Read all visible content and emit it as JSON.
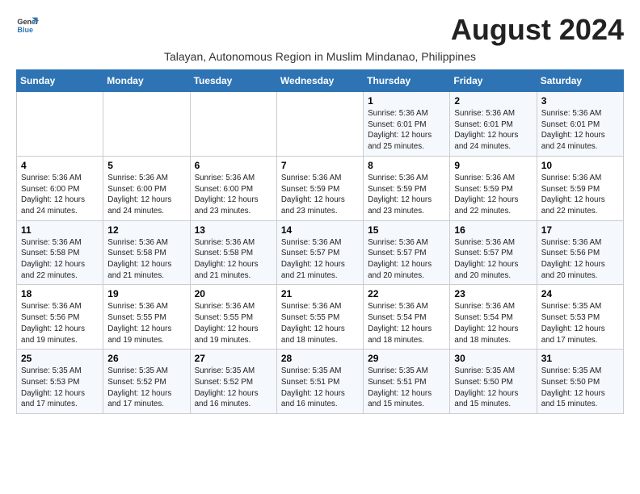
{
  "header": {
    "logo_line1": "General",
    "logo_line2": "Blue",
    "month_title": "August 2024",
    "subtitle": "Talayan, Autonomous Region in Muslim Mindanao, Philippines"
  },
  "days_of_week": [
    "Sunday",
    "Monday",
    "Tuesday",
    "Wednesday",
    "Thursday",
    "Friday",
    "Saturday"
  ],
  "weeks": [
    [
      {
        "day": "",
        "info": ""
      },
      {
        "day": "",
        "info": ""
      },
      {
        "day": "",
        "info": ""
      },
      {
        "day": "",
        "info": ""
      },
      {
        "day": "1",
        "info": "Sunrise: 5:36 AM\nSunset: 6:01 PM\nDaylight: 12 hours\nand 25 minutes."
      },
      {
        "day": "2",
        "info": "Sunrise: 5:36 AM\nSunset: 6:01 PM\nDaylight: 12 hours\nand 24 minutes."
      },
      {
        "day": "3",
        "info": "Sunrise: 5:36 AM\nSunset: 6:01 PM\nDaylight: 12 hours\nand 24 minutes."
      }
    ],
    [
      {
        "day": "4",
        "info": "Sunrise: 5:36 AM\nSunset: 6:00 PM\nDaylight: 12 hours\nand 24 minutes."
      },
      {
        "day": "5",
        "info": "Sunrise: 5:36 AM\nSunset: 6:00 PM\nDaylight: 12 hours\nand 24 minutes."
      },
      {
        "day": "6",
        "info": "Sunrise: 5:36 AM\nSunset: 6:00 PM\nDaylight: 12 hours\nand 23 minutes."
      },
      {
        "day": "7",
        "info": "Sunrise: 5:36 AM\nSunset: 5:59 PM\nDaylight: 12 hours\nand 23 minutes."
      },
      {
        "day": "8",
        "info": "Sunrise: 5:36 AM\nSunset: 5:59 PM\nDaylight: 12 hours\nand 23 minutes."
      },
      {
        "day": "9",
        "info": "Sunrise: 5:36 AM\nSunset: 5:59 PM\nDaylight: 12 hours\nand 22 minutes."
      },
      {
        "day": "10",
        "info": "Sunrise: 5:36 AM\nSunset: 5:59 PM\nDaylight: 12 hours\nand 22 minutes."
      }
    ],
    [
      {
        "day": "11",
        "info": "Sunrise: 5:36 AM\nSunset: 5:58 PM\nDaylight: 12 hours\nand 22 minutes."
      },
      {
        "day": "12",
        "info": "Sunrise: 5:36 AM\nSunset: 5:58 PM\nDaylight: 12 hours\nand 21 minutes."
      },
      {
        "day": "13",
        "info": "Sunrise: 5:36 AM\nSunset: 5:58 PM\nDaylight: 12 hours\nand 21 minutes."
      },
      {
        "day": "14",
        "info": "Sunrise: 5:36 AM\nSunset: 5:57 PM\nDaylight: 12 hours\nand 21 minutes."
      },
      {
        "day": "15",
        "info": "Sunrise: 5:36 AM\nSunset: 5:57 PM\nDaylight: 12 hours\nand 20 minutes."
      },
      {
        "day": "16",
        "info": "Sunrise: 5:36 AM\nSunset: 5:57 PM\nDaylight: 12 hours\nand 20 minutes."
      },
      {
        "day": "17",
        "info": "Sunrise: 5:36 AM\nSunset: 5:56 PM\nDaylight: 12 hours\nand 20 minutes."
      }
    ],
    [
      {
        "day": "18",
        "info": "Sunrise: 5:36 AM\nSunset: 5:56 PM\nDaylight: 12 hours\nand 19 minutes."
      },
      {
        "day": "19",
        "info": "Sunrise: 5:36 AM\nSunset: 5:55 PM\nDaylight: 12 hours\nand 19 minutes."
      },
      {
        "day": "20",
        "info": "Sunrise: 5:36 AM\nSunset: 5:55 PM\nDaylight: 12 hours\nand 19 minutes."
      },
      {
        "day": "21",
        "info": "Sunrise: 5:36 AM\nSunset: 5:55 PM\nDaylight: 12 hours\nand 18 minutes."
      },
      {
        "day": "22",
        "info": "Sunrise: 5:36 AM\nSunset: 5:54 PM\nDaylight: 12 hours\nand 18 minutes."
      },
      {
        "day": "23",
        "info": "Sunrise: 5:36 AM\nSunset: 5:54 PM\nDaylight: 12 hours\nand 18 minutes."
      },
      {
        "day": "24",
        "info": "Sunrise: 5:35 AM\nSunset: 5:53 PM\nDaylight: 12 hours\nand 17 minutes."
      }
    ],
    [
      {
        "day": "25",
        "info": "Sunrise: 5:35 AM\nSunset: 5:53 PM\nDaylight: 12 hours\nand 17 minutes."
      },
      {
        "day": "26",
        "info": "Sunrise: 5:35 AM\nSunset: 5:52 PM\nDaylight: 12 hours\nand 17 minutes."
      },
      {
        "day": "27",
        "info": "Sunrise: 5:35 AM\nSunset: 5:52 PM\nDaylight: 12 hours\nand 16 minutes."
      },
      {
        "day": "28",
        "info": "Sunrise: 5:35 AM\nSunset: 5:51 PM\nDaylight: 12 hours\nand 16 minutes."
      },
      {
        "day": "29",
        "info": "Sunrise: 5:35 AM\nSunset: 5:51 PM\nDaylight: 12 hours\nand 15 minutes."
      },
      {
        "day": "30",
        "info": "Sunrise: 5:35 AM\nSunset: 5:50 PM\nDaylight: 12 hours\nand 15 minutes."
      },
      {
        "day": "31",
        "info": "Sunrise: 5:35 AM\nSunset: 5:50 PM\nDaylight: 12 hours\nand 15 minutes."
      }
    ]
  ]
}
